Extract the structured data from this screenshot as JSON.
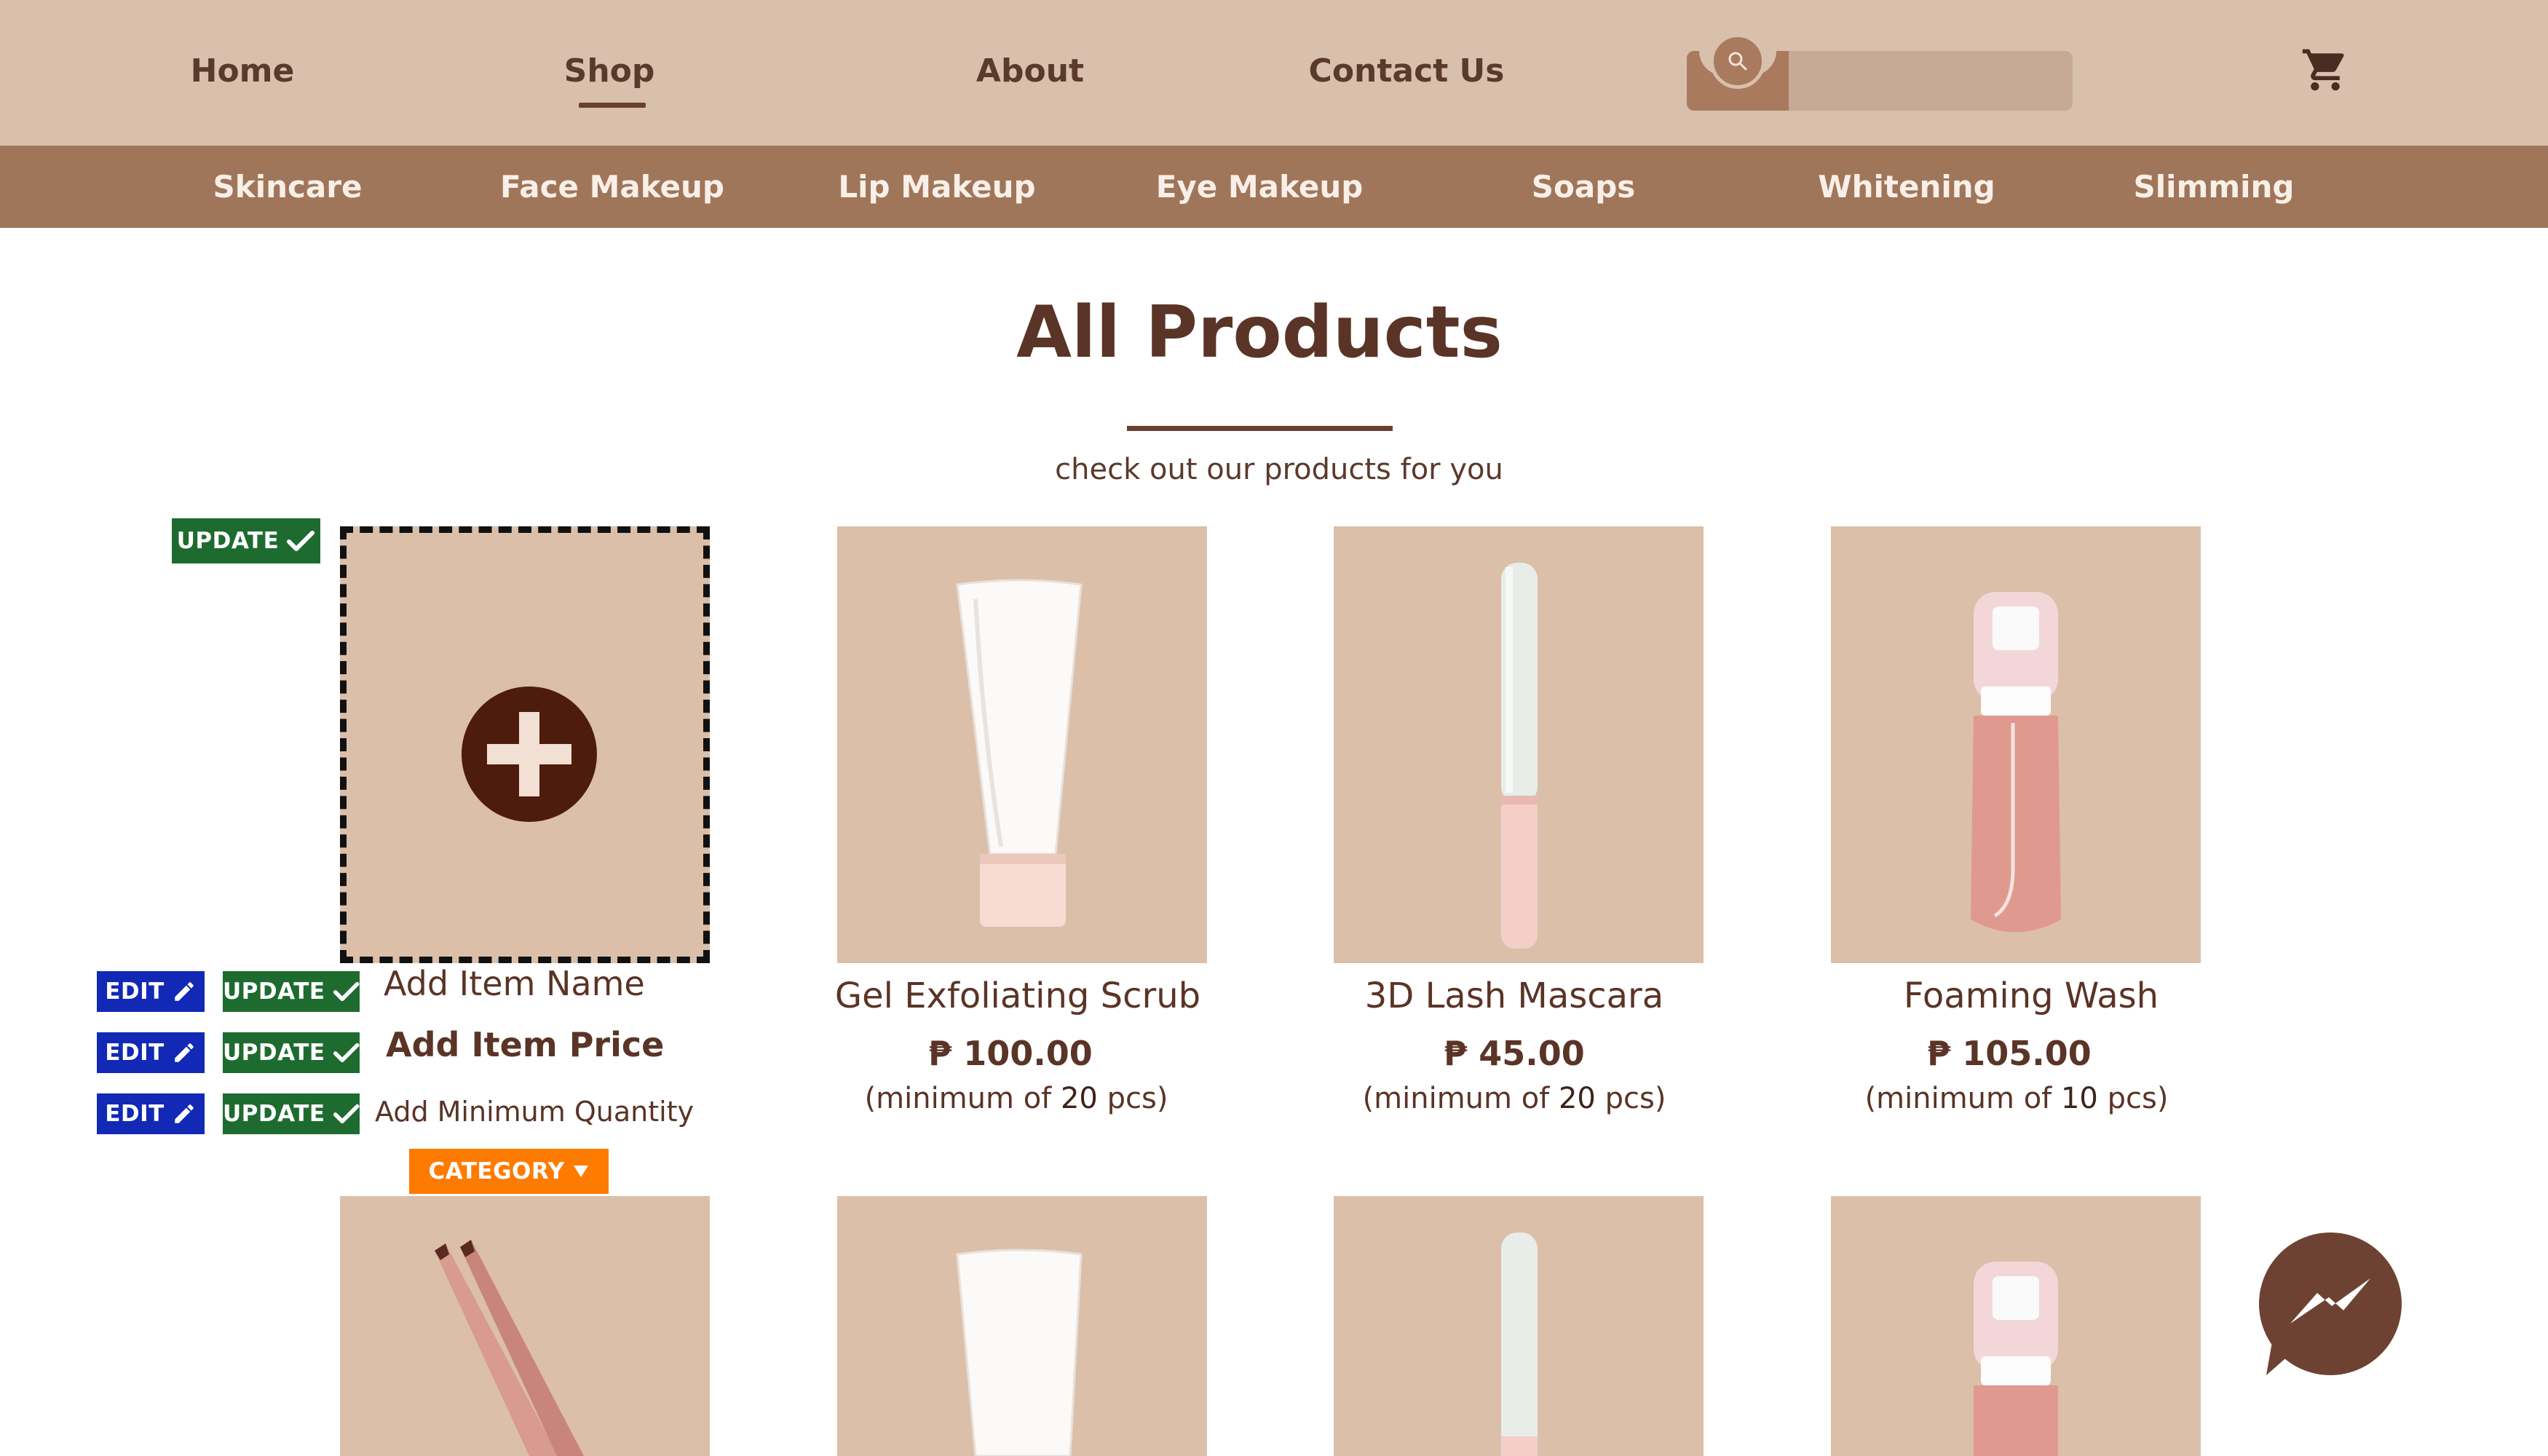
{
  "nav": {
    "links": [
      "Home",
      "Shop",
      "About",
      "Contact Us"
    ],
    "active": "Shop",
    "search": {
      "placeholder": "",
      "value": ""
    }
  },
  "categories": [
    "Skincare",
    "Face Makeup",
    "Lip Makeup",
    "Eye Makeup",
    "Soaps",
    "Whitening",
    "Slimming"
  ],
  "heading": {
    "title": "All Products",
    "subtitle": "check out our products for you"
  },
  "editor": {
    "update_label": "UPDATE",
    "edit_label": "EDIT",
    "name_placeholder": "Add Item Name",
    "price_placeholder": "Add Item Price",
    "min_qty_placeholder": "Add Minimum Quantity",
    "category_label": "CATEGORY"
  },
  "products": [
    {
      "name": "Gel Exfoliating Scrub",
      "price": "₱ 100.00",
      "min_prefix": "(minimum of ",
      "min_qty": "20",
      "min_suffix": " pcs)"
    },
    {
      "name": "3D Lash Mascara",
      "price": "₱ 45.00",
      "min_prefix": "(minimum of ",
      "min_qty": "20",
      "min_suffix": " pcs)"
    },
    {
      "name": "Foaming Wash",
      "price": "₱ 105.00",
      "min_prefix": "(minimum of ",
      "min_qty": "10",
      "min_suffix": " pcs)"
    }
  ],
  "second_row": [
    "lip-liner-pencil",
    "tube",
    "mascara",
    "foam-bottle"
  ],
  "colors": {
    "nav_bg": "#d9c0ad",
    "category_bar_bg": "#a0765a",
    "card_bg": "#dbbfa9",
    "text_brown": "#5a3426",
    "update_green": "#1e6b30",
    "edit_blue": "#1129b5",
    "category_orange": "#ff7b00"
  },
  "icons": [
    "search-icon",
    "cart-icon",
    "plus-icon",
    "check-icon",
    "pencil-icon",
    "caret-down-icon",
    "messenger-icon"
  ]
}
